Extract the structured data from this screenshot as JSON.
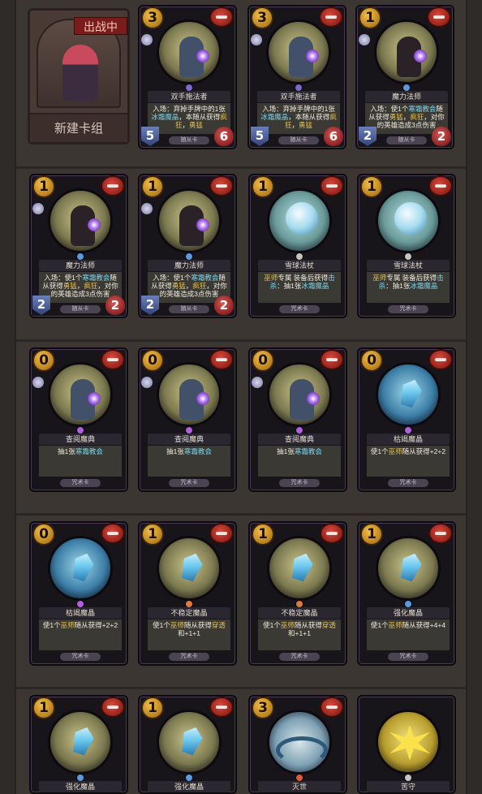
{
  "hero": {
    "status_badge": "出战中",
    "deck_label": "新建卡组"
  },
  "rows": [
    [
      {
        "cost": "3",
        "name": "双手施法者",
        "text_parts": [
          [
            "入场：弃掉手牌中的1张",
            ""
          ],
          [
            "冰霜魔晶",
            "hl2"
          ],
          [
            "，本随从获得",
            ""
          ],
          [
            "疯狂",
            "hl"
          ],
          [
            "，",
            ""
          ],
          [
            "勇猛",
            "hl"
          ]
        ],
        "atk": "5",
        "hp": "6",
        "footer": "随从卡",
        "art": "wiz",
        "gem": "#7a6bd0"
      },
      {
        "cost": "3",
        "name": "双手施法者",
        "text_parts": [
          [
            "入场：弃掉手牌中的1张",
            ""
          ],
          [
            "冰霜魔晶",
            "hl2"
          ],
          [
            "，本随从获得",
            ""
          ],
          [
            "疯狂",
            "hl"
          ],
          [
            "，",
            ""
          ],
          [
            "勇猛",
            "hl"
          ]
        ],
        "atk": "5",
        "hp": "6",
        "footer": "随从卡",
        "art": "wiz",
        "gem": "#7a6bd0"
      },
      {
        "cost": "1",
        "name": "魔力法师",
        "text_parts": [
          [
            "入场：使1个",
            ""
          ],
          [
            "寒霜教会",
            "hl2"
          ],
          [
            "随从获得",
            ""
          ],
          [
            "勇猛",
            "hl"
          ],
          [
            "，",
            ""
          ],
          [
            "疯狂",
            "hl"
          ],
          [
            "，对你的英雄造成3点伤害",
            ""
          ]
        ],
        "atk": "2",
        "hp": "2",
        "footer": "随从卡",
        "art": "dark",
        "gem": "#5a9be0"
      }
    ],
    [
      {
        "cost": "1",
        "name": "魔力法师",
        "text_parts": [
          [
            "入场：使1个",
            ""
          ],
          [
            "寒霜教会",
            "hl2"
          ],
          [
            "随从获得",
            ""
          ],
          [
            "勇猛",
            "hl"
          ],
          [
            "，",
            ""
          ],
          [
            "疯狂",
            "hl"
          ],
          [
            "，对你的英雄造成3点伤害",
            ""
          ]
        ],
        "atk": "2",
        "hp": "2",
        "footer": "随从卡",
        "art": "dark",
        "gem": "#5a9be0"
      },
      {
        "cost": "1",
        "name": "魔力法师",
        "text_parts": [
          [
            "入场：使1个",
            ""
          ],
          [
            "寒霜教会",
            "hl2"
          ],
          [
            "随从获得",
            ""
          ],
          [
            "勇猛",
            "hl"
          ],
          [
            "，",
            ""
          ],
          [
            "疯狂",
            "hl"
          ],
          [
            "，对你的英雄造成3点伤害",
            ""
          ]
        ],
        "atk": "2",
        "hp": "2",
        "footer": "随从卡",
        "art": "dark",
        "gem": "#5a9be0"
      },
      {
        "cost": "1",
        "name": "雪球法杖",
        "text_parts": [
          [
            "巫师",
            "hl"
          ],
          [
            "专属 装备后获得",
            ""
          ],
          [
            "击杀",
            "hl2"
          ],
          [
            "：抽1张",
            ""
          ],
          [
            "冰霜魔晶",
            "hl2"
          ]
        ],
        "atk": "",
        "hp": "",
        "footer": "咒术卡",
        "art": "teal",
        "gem": "#c8c4c0"
      },
      {
        "cost": "1",
        "name": "雪球法杖",
        "text_parts": [
          [
            "巫师",
            "hl"
          ],
          [
            "专属 装备后获得",
            ""
          ],
          [
            "击杀",
            "hl2"
          ],
          [
            "：抽1张",
            ""
          ],
          [
            "冰霜魔晶",
            "hl2"
          ]
        ],
        "atk": "",
        "hp": "",
        "footer": "咒术卡",
        "art": "teal",
        "gem": "#c8c4c0"
      }
    ],
    [
      {
        "cost": "0",
        "name": "查阅魔典",
        "text_parts": [
          [
            "抽1张",
            ""
          ],
          [
            "寒霜教会",
            "hl2"
          ]
        ],
        "atk": "",
        "hp": "",
        "footer": "咒术卡",
        "art": "wiz",
        "gem": "#b25fe0"
      },
      {
        "cost": "0",
        "name": "查阅魔典",
        "text_parts": [
          [
            "抽1张",
            ""
          ],
          [
            "寒霜教会",
            "hl2"
          ]
        ],
        "atk": "",
        "hp": "",
        "footer": "咒术卡",
        "art": "wiz",
        "gem": "#b25fe0"
      },
      {
        "cost": "0",
        "name": "查阅魔典",
        "text_parts": [
          [
            "抽1张",
            ""
          ],
          [
            "寒霜教会",
            "hl2"
          ]
        ],
        "atk": "",
        "hp": "",
        "footer": "咒术卡",
        "art": "wiz",
        "gem": "#b25fe0"
      },
      {
        "cost": "0",
        "name": "枯竭魔晶",
        "text_parts": [
          [
            "使1个",
            ""
          ],
          [
            "巫师",
            "hl"
          ],
          [
            "随从获得+2+2",
            ""
          ]
        ],
        "atk": "",
        "hp": "",
        "footer": "咒术卡",
        "art": "blue",
        "gem": "#b25fe0"
      }
    ],
    [
      {
        "cost": "0",
        "name": "枯竭魔晶",
        "text_parts": [
          [
            "使1个",
            ""
          ],
          [
            "巫师",
            "hl"
          ],
          [
            "随从获得+2+2",
            ""
          ]
        ],
        "atk": "",
        "hp": "",
        "footer": "咒术卡",
        "art": "blue",
        "gem": "#b25fe0"
      },
      {
        "cost": "1",
        "name": "不稳定魔晶",
        "text_parts": [
          [
            "使1个",
            ""
          ],
          [
            "巫师",
            "hl"
          ],
          [
            "随从获得",
            ""
          ],
          [
            "穿透",
            "hl"
          ],
          [
            "和+1+1",
            ""
          ]
        ],
        "atk": "",
        "hp": "",
        "footer": "咒术卡",
        "art": "crystal",
        "gem": "#e07a3a"
      },
      {
        "cost": "1",
        "name": "不稳定魔晶",
        "text_parts": [
          [
            "使1个",
            ""
          ],
          [
            "巫师",
            "hl"
          ],
          [
            "随从获得",
            ""
          ],
          [
            "穿透",
            "hl"
          ],
          [
            "和+1+1",
            ""
          ]
        ],
        "atk": "",
        "hp": "",
        "footer": "咒术卡",
        "art": "crystal",
        "gem": "#e07a3a"
      },
      {
        "cost": "1",
        "name": "强化魔晶",
        "text_parts": [
          [
            "使1个",
            ""
          ],
          [
            "巫师",
            "hl"
          ],
          [
            "随从获得+4+4",
            ""
          ]
        ],
        "atk": "",
        "hp": "",
        "footer": "咒术卡",
        "art": "crystal",
        "gem": "#5a9be0"
      }
    ],
    [
      {
        "cost": "1",
        "name": "强化魔晶",
        "text_parts": [],
        "atk": "",
        "hp": "",
        "footer": "",
        "art": "crystal",
        "gem": "#5a9be0"
      },
      {
        "cost": "1",
        "name": "强化魔晶",
        "text_parts": [],
        "atk": "",
        "hp": "",
        "footer": "",
        "art": "crystal",
        "gem": "#5a9be0"
      },
      {
        "cost": "3",
        "name": "灭世",
        "text_parts": [],
        "atk": "",
        "hp": "",
        "footer": "",
        "art": "sea",
        "gem": "#e05a3a"
      },
      {
        "cost": "",
        "name": "苦守",
        "text_parts": [],
        "atk": "",
        "hp": "",
        "footer": "",
        "art": "gold",
        "gem": "#c8c4c0"
      }
    ]
  ]
}
